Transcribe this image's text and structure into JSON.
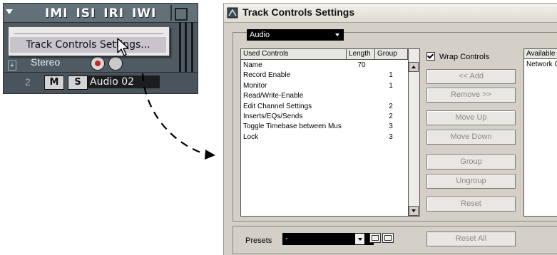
{
  "track_header": {
    "buttons_label": "IMI ISI IRI IWI",
    "menu_item": "Track Controls Settings...",
    "stereo_label": "Stereo",
    "track_number": "2",
    "mute_label": "M",
    "solo_label": "S",
    "track_name": "Audio 02",
    "expand_label": "+"
  },
  "dialog": {
    "title": "Track Controls Settings",
    "track_type": "Audio",
    "list": {
      "headers": [
        "Used Controls",
        "Length",
        "Group"
      ],
      "rows": [
        {
          "name": "Name",
          "length": "70",
          "group": ""
        },
        {
          "name": "Record Enable",
          "length": "",
          "group": "1"
        },
        {
          "name": "Monitor",
          "length": "",
          "group": "1"
        },
        {
          "name": "Read/Write-Enable",
          "length": "",
          "group": ""
        },
        {
          "name": "Edit Channel Settings",
          "length": "",
          "group": "2"
        },
        {
          "name": "Inserts/EQs/Sends",
          "length": "",
          "group": "2"
        },
        {
          "name": "Toggle Timebase between Mus",
          "length": "",
          "group": "3"
        },
        {
          "name": "Lock",
          "length": "",
          "group": "3"
        }
      ]
    },
    "wrap_controls": {
      "label": "Wrap Controls",
      "checked": true
    },
    "buttons": {
      "add": "<< Add",
      "remove": "Remove >>",
      "move_up": "Move Up",
      "move_down": "Move Down",
      "group": "Group",
      "ungroup": "Ungroup",
      "reset": "Reset",
      "reset_all": "Reset All"
    },
    "available": {
      "header": "Available",
      "items": [
        "Network C"
      ]
    },
    "presets": {
      "label": "Presets",
      "value": "-"
    }
  }
}
